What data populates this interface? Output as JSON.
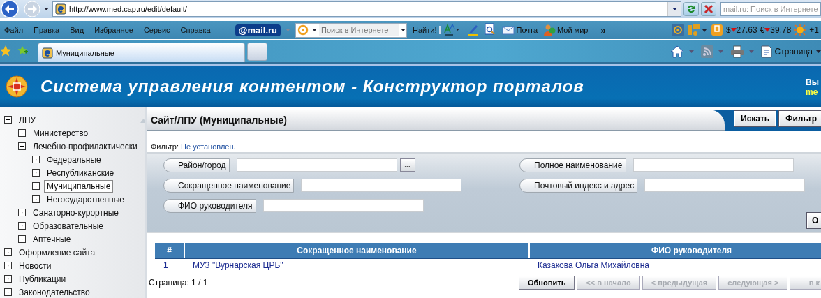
{
  "browser": {
    "url": "http://www.med.cap.ru/edit/default/",
    "search_placeholder": "mail.ru: Поиск в Интернете"
  },
  "menu": [
    "Файл",
    "Правка",
    "Вид",
    "Избранное",
    "Сервис",
    "Справка"
  ],
  "toolbar": {
    "logo": "@mail.ru",
    "search_placeholder": "Поиск в Интернете",
    "find_button": "Найти!",
    "links": [
      {
        "kind": "mail",
        "label": "Почта"
      },
      {
        "kind": "people",
        "label": "Мой мир"
      }
    ],
    "more": "»",
    "rates": [
      {
        "symbol": "$",
        "value": "27.63"
      },
      {
        "symbol": "€",
        "value": "39.78"
      }
    ],
    "weather": "+1"
  },
  "tabs": [
    {
      "label": "Муниципальные",
      "selected": true
    }
  ],
  "command_bar": {
    "page_menu": "Страница"
  },
  "header": {
    "title": "Система управления контентом - Конструктор порталов",
    "user_label": "Вы",
    "user_name": "me"
  },
  "tree": [
    {
      "label": "ЛПУ",
      "expanded": true,
      "selected": false,
      "children": [
        {
          "label": "Министерство",
          "expanded": false,
          "selected": false
        },
        {
          "label": "Лечебно-профилактически",
          "expanded": true,
          "selected": false,
          "children": [
            {
              "label": "Федеральные",
              "expanded": false,
              "selected": false
            },
            {
              "label": "Республиканские",
              "expanded": false,
              "selected": false
            },
            {
              "label": "Муниципальные",
              "expanded": false,
              "selected": true
            },
            {
              "label": "Негосударственные",
              "expanded": false,
              "selected": false
            }
          ]
        },
        {
          "label": "Санаторно-курортные",
          "expanded": false,
          "selected": false
        },
        {
          "label": "Образовательные",
          "expanded": false,
          "selected": false
        },
        {
          "label": "Аптечные",
          "expanded": false,
          "selected": false
        }
      ]
    },
    {
      "label": "Оформление сайта",
      "expanded": false,
      "selected": false
    },
    {
      "label": "Новости",
      "expanded": false,
      "selected": false
    },
    {
      "label": "Публикации",
      "expanded": false,
      "selected": false
    },
    {
      "label": "Законодательство",
      "expanded": false,
      "selected": false
    }
  ],
  "content": {
    "title": "Сайт/ЛПУ (Муниципальные)",
    "actions": [
      "Искать",
      "Фильтр"
    ],
    "filter_label": "Фильтр:",
    "filter_value": "Не установлен.",
    "fields": [
      {
        "label": "Район/город",
        "browse_button": "..."
      },
      {
        "label": "Полное наименование"
      },
      {
        "label": "Сокращенное наименование"
      },
      {
        "label": "Почтовый индекс и адрес"
      },
      {
        "label": "ФИО руководителя"
      }
    ],
    "apply_button": "О",
    "table": {
      "columns": [
        "#",
        "Сокращенное наименование",
        "ФИО руководителя"
      ],
      "rows": [
        [
          "1",
          "МУЗ \"Вурнарская ЦРБ\"",
          "Казакова Ольга Михайловна"
        ]
      ]
    },
    "page_info": "Страница: 1 / 1",
    "pager": [
      {
        "label": "Обновить",
        "disabled": false
      },
      {
        "label": "<< в начало",
        "disabled": true
      },
      {
        "label": "< предыдущая",
        "disabled": true
      },
      {
        "label": "следующая >",
        "disabled": true
      },
      {
        "label": "в к",
        "disabled": true
      }
    ]
  }
}
